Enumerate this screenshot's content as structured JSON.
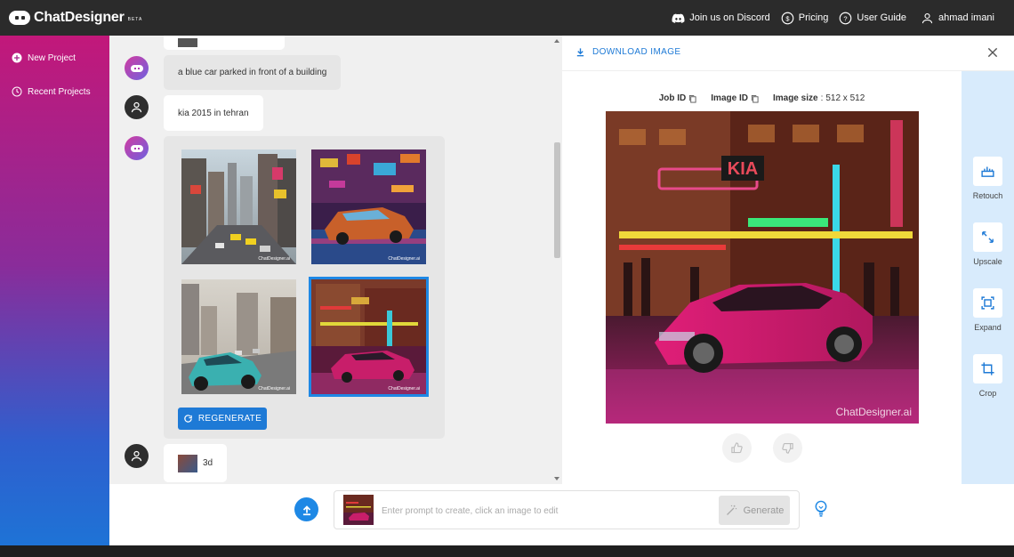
{
  "app": {
    "logo_text": "ChatDesigner",
    "logo_badge": "BETA"
  },
  "topnav": {
    "discord": "Join us on Discord",
    "pricing": "Pricing",
    "guide": "User Guide",
    "user": "ahmad imani"
  },
  "sidebar": {
    "new_project": "New Project",
    "recent_projects": "Recent Projects"
  },
  "chat": {
    "messages": [
      {
        "role": "bot",
        "text": "a blue car parked in front of a building"
      },
      {
        "role": "user",
        "text": "kia 2015 in tehran"
      },
      {
        "role": "user",
        "text": "3d"
      }
    ],
    "image_group": {
      "images": [
        {
          "name": "city-street-yellow-taxis"
        },
        {
          "name": "neon-retro-car"
        },
        {
          "name": "teal-car-city"
        },
        {
          "name": "pink-car-neon-building",
          "selected": true
        }
      ],
      "watermark": "ChatDesigner.ai",
      "regenerate_label": "REGENERATE"
    }
  },
  "prompt": {
    "placeholder": "Enter prompt to create, click an image to edit",
    "generate_label": "Generate"
  },
  "viewer": {
    "download_label": "DOWNLOAD IMAGE",
    "job_id_label": "Job ID",
    "image_id_label": "Image ID",
    "image_size_label": "Image size",
    "image_size_value": "512 x 512",
    "watermark": "ChatDesigner.ai",
    "overlay_sign": "KIA"
  },
  "tools": [
    {
      "label": "Retouch",
      "icon": "retouch-icon"
    },
    {
      "label": "Upscale",
      "icon": "upscale-icon"
    },
    {
      "label": "Expand",
      "icon": "expand-icon"
    },
    {
      "label": "Crop",
      "icon": "crop-icon"
    }
  ],
  "colors": {
    "accent": "#1e7ad6",
    "topbar": "#2b2b2b",
    "sidebar_top": "#c2187a",
    "sidebar_bottom": "#1e73d6",
    "tool_rail": "#d8ebfc",
    "selected_outline": "#1e88e5"
  }
}
